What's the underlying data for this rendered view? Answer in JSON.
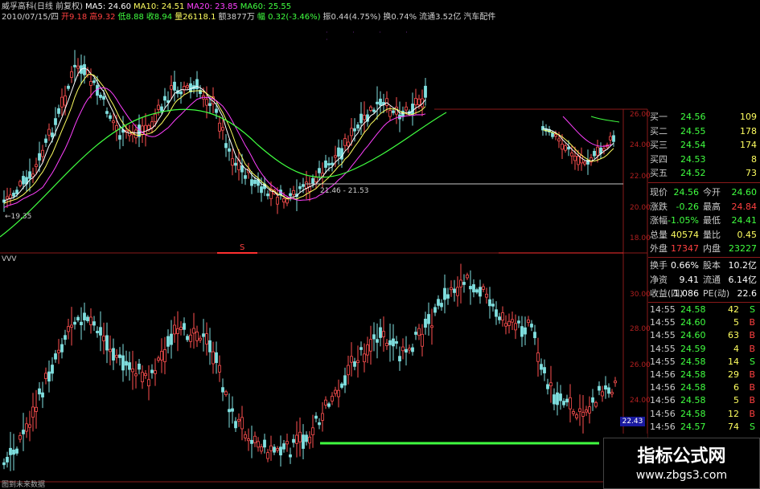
{
  "header": {
    "line1": [
      {
        "text": "威孚高科(日线 前复权)",
        "color": "#d0d0d0"
      },
      {
        "text": "MA5: 24.60",
        "color": "#ffffff"
      },
      {
        "text": "MA10: 24.51",
        "color": "#ffff60"
      },
      {
        "text": "MA20: 23.85",
        "color": "#ff40ff"
      },
      {
        "text": "MA60: 25.55",
        "color": "#40ff40"
      }
    ],
    "line2": [
      {
        "text": "2010/07/15/四",
        "color": "#d0d0d0"
      },
      {
        "text": "开9.18",
        "color": "#ff4040"
      },
      {
        "text": "高9.32",
        "color": "#ff4040"
      },
      {
        "text": "低8.88",
        "color": "#40ff40"
      },
      {
        "text": "收8.94",
        "color": "#40ff40"
      },
      {
        "text": "量26118.1",
        "color": "#ffff60"
      },
      {
        "text": "额3877万",
        "color": "#d0d0d0"
      },
      {
        "text": "幅 0.32(-3.46%)",
        "color": "#40ff40"
      },
      {
        "text": "振0.44(4.75%)",
        "color": "#d0d0d0"
      },
      {
        "text": "换0.74%",
        "color": "#d0d0d0"
      },
      {
        "text": "流通3.52亿",
        "color": "#d0d0d0"
      },
      {
        "text": "汽车配件",
        "color": "#d0d0d0"
      }
    ]
  },
  "annotations": {
    "low_left": "←19.35",
    "range": "21.46 - 21.53",
    "marker": "S",
    "sub_label": "VVV",
    "bottom_left": "图到未来数据"
  },
  "axis": {
    "upper": [
      "26.00",
      "24.00",
      "22.00",
      "20.00",
      "18.00"
    ],
    "lower": [
      "30.00",
      "28.00",
      "26.00",
      "24.00"
    ],
    "current_price": "22.43"
  },
  "quotes": {
    "sell": [],
    "buy": [
      {
        "label": "买一",
        "price": "24.56",
        "vol": "109"
      },
      {
        "label": "买二",
        "price": "24.55",
        "vol": "178"
      },
      {
        "label": "买三",
        "price": "24.54",
        "vol": "174"
      },
      {
        "label": "买四",
        "price": "24.53",
        "vol": "8"
      },
      {
        "label": "买五",
        "price": "24.52",
        "vol": "73"
      }
    ]
  },
  "stats": [
    {
      "l1": "现价",
      "v1": "24.56",
      "c1": "#40ff40",
      "l2": "今开",
      "v2": "24.60",
      "c2": "#40ff40"
    },
    {
      "l1": "涨跌",
      "v1": "-0.26",
      "c1": "#40ff40",
      "l2": "最高",
      "v2": "24.84",
      "c2": "#ff4040"
    },
    {
      "l1": "涨幅",
      "v1": "-1.05%",
      "c1": "#40ff40",
      "l2": "最低",
      "v2": "24.41",
      "c2": "#40ff40"
    },
    {
      "l1": "总量",
      "v1": "40574",
      "c1": "#ffff60",
      "l2": "量比",
      "v2": "0.45",
      "c2": "#ffff60"
    },
    {
      "l1": "外盘",
      "v1": "17347",
      "c1": "#ff4040",
      "l2": "内盘",
      "v2": "23227",
      "c2": "#40ff40"
    }
  ],
  "stats2": [
    {
      "l1": "换手",
      "v1": "0.66%",
      "l2": "股本",
      "v2": "10.2亿"
    },
    {
      "l1": "净资",
      "v1": "9.41",
      "l2": "流通",
      "v2": "6.14亿"
    },
    {
      "l1": "收益(四)",
      "v1": "1.086",
      "l2": "PE(动)",
      "v2": "22.6"
    }
  ],
  "ticks": [
    {
      "time": "14:55",
      "price": "24.58",
      "vol": "42",
      "side": "S"
    },
    {
      "time": "14:55",
      "price": "24.60",
      "vol": "5",
      "side": "B"
    },
    {
      "time": "14:55",
      "price": "24.60",
      "vol": "63",
      "side": "B"
    },
    {
      "time": "14:55",
      "price": "24.59",
      "vol": "4",
      "side": "B"
    },
    {
      "time": "14:55",
      "price": "24.58",
      "vol": "14",
      "side": "S"
    },
    {
      "time": "14:56",
      "price": "24.58",
      "vol": "29",
      "side": "B"
    },
    {
      "time": "14:56",
      "price": "24.58",
      "vol": "6",
      "side": "B"
    },
    {
      "time": "14:56",
      "price": "24.58",
      "vol": "5",
      "side": "B"
    },
    {
      "time": "14:56",
      "price": "24.58",
      "vol": "12",
      "side": "B"
    },
    {
      "time": "14:56",
      "price": "24.57",
      "vol": "74",
      "side": "S"
    }
  ],
  "watermark": {
    "line1": "指标公式网",
    "line2": "www.zbgs3.com"
  },
  "colors": {
    "up": "#ff4040",
    "down": "#40ff40",
    "ma5": "#ffffff",
    "ma10": "#ffff60",
    "ma20": "#ff40ff",
    "ma60": "#40ff40",
    "axis": "#b02020"
  }
}
